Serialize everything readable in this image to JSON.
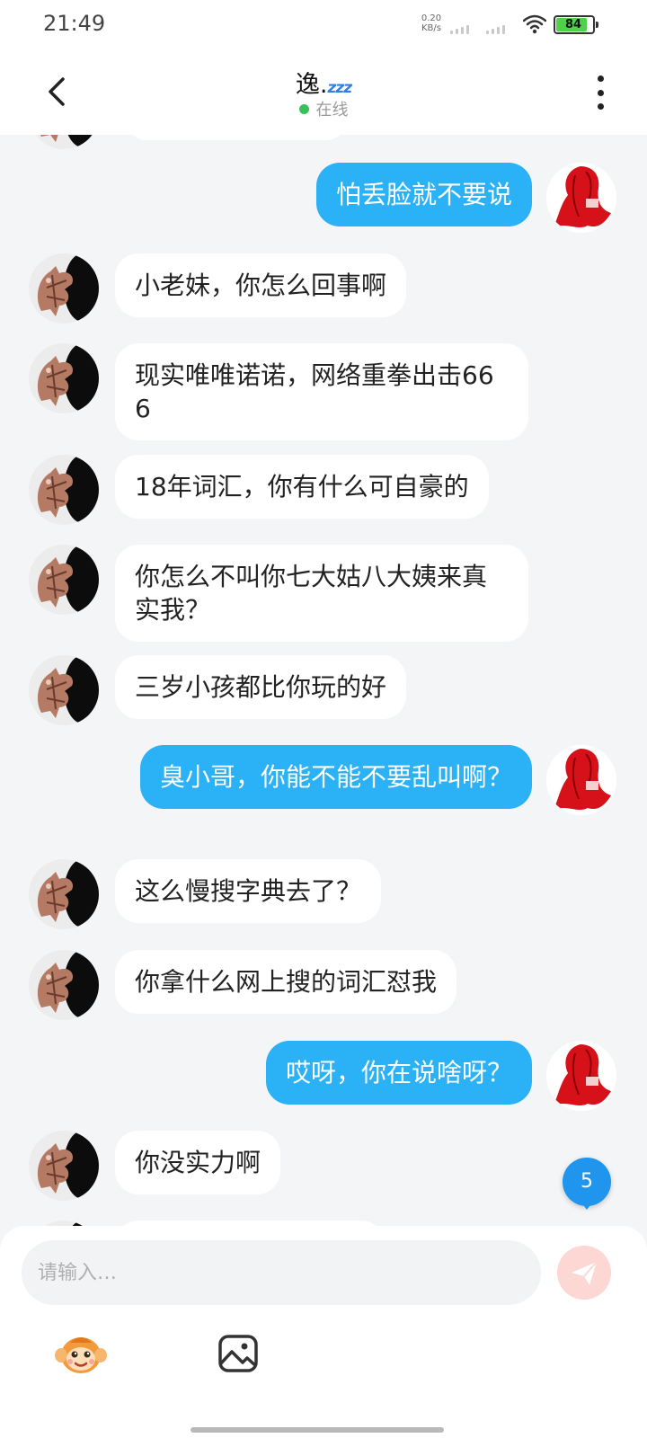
{
  "status_bar": {
    "time": "21:49",
    "net_speed_value": "0.20",
    "net_speed_unit": "KB/s",
    "battery": "84"
  },
  "header": {
    "contact_name": "逸.",
    "name_emoji": "zzz",
    "status": "在线"
  },
  "messages": [
    {
      "side": "right",
      "text": "怕丢脸就不要说"
    },
    {
      "side": "left",
      "text": "小老妹，你怎么回事啊"
    },
    {
      "side": "left",
      "text": "现实唯唯诺诺，网络重拳出击666"
    },
    {
      "side": "left",
      "text": "18年词汇，你有什么可自豪的"
    },
    {
      "side": "left",
      "text": "你怎么不叫你七大姑八大姨来真实我？"
    },
    {
      "side": "left",
      "text": "三岁小孩都比你玩的好"
    },
    {
      "side": "right",
      "text": "臭小哥，你能不能不要乱叫啊？"
    },
    {
      "side": "left",
      "text": "这么慢搜字典去了？"
    },
    {
      "side": "left",
      "text": "你拿什么网上搜的词汇怼我"
    },
    {
      "side": "right",
      "text": "哎呀，你在说啥呀？"
    },
    {
      "side": "left",
      "text": "你没实力啊"
    }
  ],
  "unread_count": "5",
  "input": {
    "placeholder": "请输入…"
  },
  "colors": {
    "outgoing_bubble": "#2bb1f5",
    "incoming_bubble": "#ffffff",
    "background": "#f4f5f7",
    "online_dot": "#36c15b",
    "badge": "#1f95ee"
  },
  "icons": {
    "back": "chevron-left-icon",
    "more": "more-vertical-icon",
    "send": "send-icon",
    "emoji": "monkey-emoji-icon",
    "image": "image-icon"
  }
}
